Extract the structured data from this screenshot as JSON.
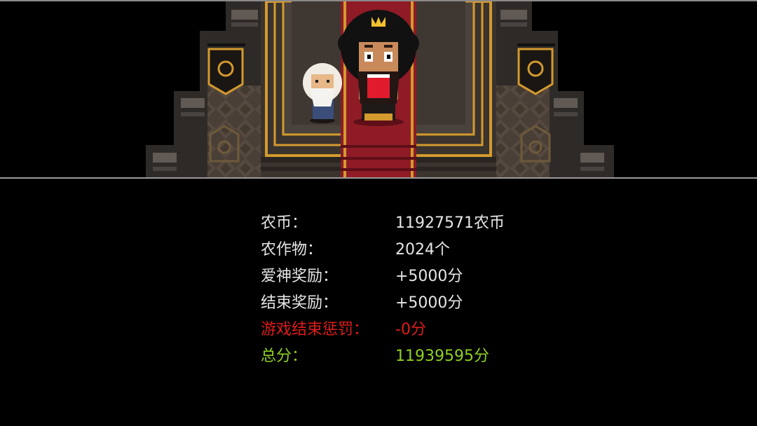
{
  "scene": {
    "characters": [
      "elder-sage",
      "king"
    ],
    "colors": {
      "carpet": "#8e1b26",
      "gold_trim": "#d49a2e",
      "stone_dark": "#2b2724",
      "stone_light": "#5a524b",
      "floor": "#4a3f36"
    }
  },
  "results": {
    "coins": {
      "label": "农币：",
      "value": "11927571农币"
    },
    "crops": {
      "label": "农作物：",
      "value": "2024个"
    },
    "cupid_bonus": {
      "label": "爱神奖励：",
      "value": "+5000分"
    },
    "end_bonus": {
      "label": "结束奖励：",
      "value": "+5000分"
    },
    "game_over_penalty": {
      "label": "游戏结束惩罚：",
      "value": "-0分"
    },
    "total": {
      "label": "总分：",
      "value": "11939595分"
    }
  },
  "colors": {
    "text": "#e6e6e6",
    "penalty": "#e01b1b",
    "total": "#8fd01f"
  }
}
